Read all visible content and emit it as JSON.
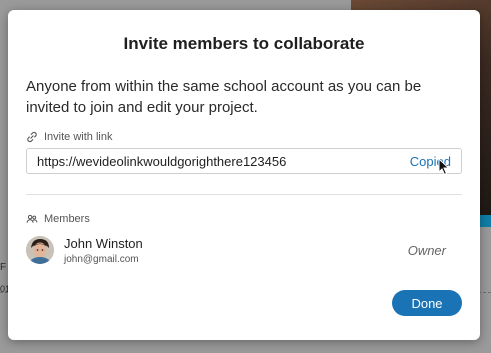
{
  "dialog": {
    "title": "Invite members to collaborate",
    "description": "Anyone from within the same school account as you can be invited to join and edit your project.",
    "invite_label": "Invite with link",
    "invite_link": "https://wevideolinkwouldgorighthere123456",
    "copy_status": "Copied",
    "members_label": "Members",
    "done_label": "Done"
  },
  "members": [
    {
      "name": "John Winston",
      "email": "john@gmail.com",
      "role": "Owner"
    }
  ],
  "background": {
    "left_text_1": "F",
    "left_text_2": "01"
  },
  "colors": {
    "accent": "#1a73b5",
    "overlay": "#9a9a9a"
  },
  "icons": {
    "invite": "link-icon",
    "members": "members-icon",
    "cursor": "mouse-cursor-icon"
  }
}
